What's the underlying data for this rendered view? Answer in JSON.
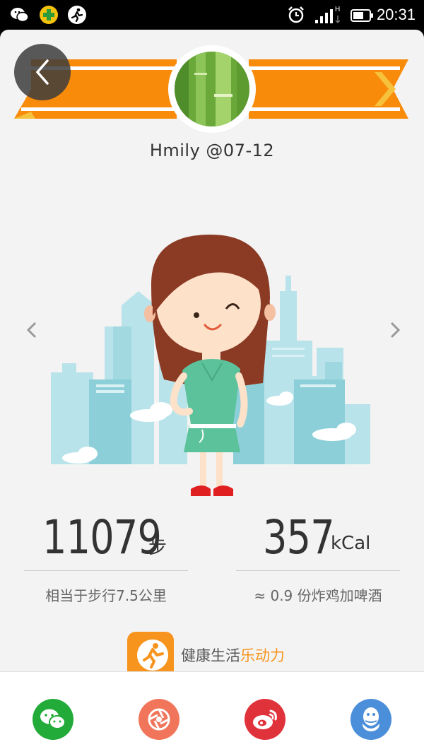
{
  "status_bar": {
    "time": "20:31",
    "icons": [
      "wechat-icon",
      "plus-app-icon",
      "runner-icon",
      "alarm-icon",
      "signal-icon",
      "battery-icon"
    ]
  },
  "header": {
    "username": "Hmily  @07-12",
    "back_icon": "chevron-left-icon",
    "banner_color": "#f98b0b"
  },
  "stats": {
    "steps": {
      "value": "11079",
      "unit": "步",
      "sub": "相当于步行7.5公里"
    },
    "calories": {
      "value": "357",
      "unit": "kCal",
      "sub": "≈ 0.9 份炸鸡加啤酒"
    }
  },
  "promo": {
    "text": "健康生活",
    "highlight": "乐动力",
    "accent": "#f7941d"
  },
  "share": {
    "items": [
      {
        "icon": "wechat-icon",
        "color": "#22ab38"
      },
      {
        "icon": "moments-icon",
        "color": "#f1755a"
      },
      {
        "icon": "weibo-icon",
        "color": "#e0323b"
      },
      {
        "icon": "qq-icon",
        "color": "#4b8ed9"
      }
    ]
  }
}
